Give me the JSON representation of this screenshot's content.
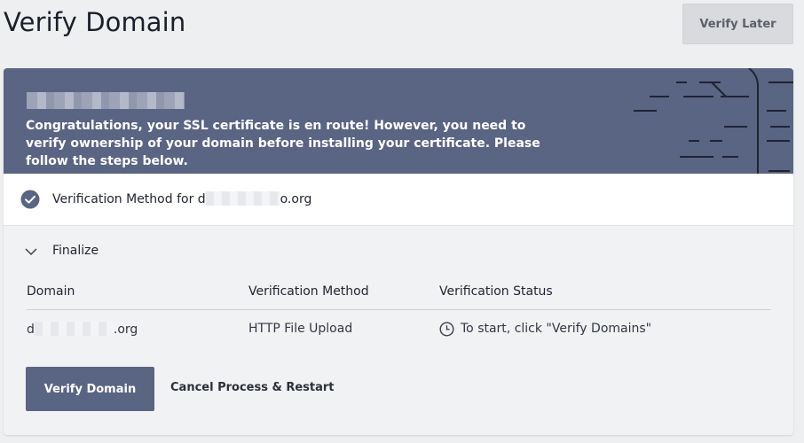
{
  "page": {
    "title": "Verify Domain",
    "verify_later_label": "Verify Later"
  },
  "banner": {
    "message": "Congratulations, your SSL certificate is en route! However, you need to verify ownership of your domain before installing your certificate. Please follow the steps below.",
    "background_color": "#5a6483"
  },
  "method_row": {
    "label_prefix": "Verification Method for d",
    "label_suffix": "o.org",
    "icon": "check-circle-icon"
  },
  "finalize": {
    "label": "Finalize",
    "icon": "chevron-down-icon"
  },
  "table": {
    "headers": [
      "Domain",
      "Verification Method",
      "Verification Status"
    ],
    "rows": [
      {
        "domain_prefix": "d",
        "domain_suffix": ".org",
        "method": "HTTP File Upload",
        "status_icon": "clock-icon",
        "status": "To start, click \"Verify Domains\""
      }
    ]
  },
  "actions": {
    "verify_domain_label": "Verify Domain",
    "cancel_label": "Cancel Process & Restart"
  },
  "colors": {
    "primary": "#5a6483",
    "page_bg": "#eeeff1"
  }
}
